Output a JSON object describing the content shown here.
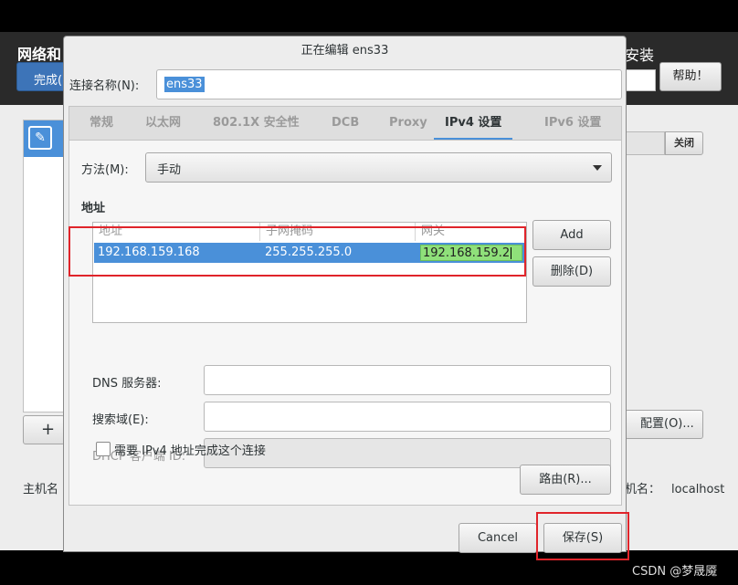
{
  "background": {
    "title": "网络和",
    "done_button": "完成(",
    "install_label": "安装",
    "help_button": "帮助！",
    "toggle_label": "关闭",
    "add_symbol": "+",
    "config_button": "配置(O)...",
    "hostname_label": "主机名",
    "hostname_right_label": "机名：",
    "hostname_value": "localhost"
  },
  "dialog": {
    "title": "正在编辑 ens33",
    "connection_name_label": "连接名称(N):",
    "connection_name_value": "ens33",
    "tabs": [
      {
        "label": "常规"
      },
      {
        "label": "以太网"
      },
      {
        "label": "802.1X 安全性"
      },
      {
        "label": "DCB"
      },
      {
        "label": "Proxy"
      },
      {
        "label": "IPv4 设置"
      },
      {
        "label": "IPv6 设置"
      }
    ],
    "active_tab": "IPv4 设置",
    "method_label": "方法(M):",
    "method_value": "手动",
    "addresses_heading": "地址",
    "columns": [
      "地址",
      "子网掩码",
      "网关"
    ],
    "address_row": {
      "address": "192.168.159.168",
      "netmask": "255.255.255.0",
      "gateway": "192.168.159.2"
    },
    "add_button": "Add",
    "delete_button": "删除(D)",
    "dns_label": "DNS 服务器:",
    "search_label": "搜索域(E):",
    "dhcp_label": "DHCP 客户端 ID:",
    "require_label": "需要 IPv4 地址完成这个连接",
    "require_checked": false,
    "routes_button": "路由(R)...",
    "cancel_button": "Cancel",
    "save_button": "保存(S)"
  },
  "watermark": "CSDN @梦晟魇",
  "colors": {
    "selection": "#4a90d9",
    "gateway_edit": "#8fe07a",
    "annotation": "#e0242a"
  }
}
